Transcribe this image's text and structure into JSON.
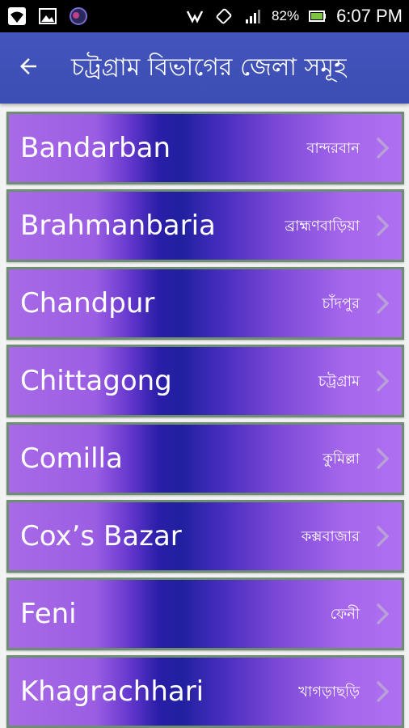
{
  "status_bar": {
    "battery_percent": "82%",
    "time": "6:07 PM",
    "left_icons": [
      "wifi-icon",
      "image-icon",
      "app-notification-icon"
    ],
    "right_icons": [
      "headset-icon",
      "rotate-icon",
      "signal-icon",
      "battery-icon"
    ]
  },
  "app_bar": {
    "title": "চট্রগ্রাম বিভাগের জেলা সমূহ",
    "back_icon": "arrow-left-icon"
  },
  "districts": [
    {
      "name": "Bandarban",
      "bangla": "বান্দরবান"
    },
    {
      "name": "Brahmanbaria",
      "bangla": "ব্রাহ্মণবাড়িয়া"
    },
    {
      "name": "Chandpur",
      "bangla": "চাঁদপুর"
    },
    {
      "name": "Chittagong",
      "bangla": "চট্রগ্রাম"
    },
    {
      "name": "Comilla",
      "bangla": "কুমিল্লা"
    },
    {
      "name": "Cox’s Bazar",
      "bangla": "কক্সবাজার"
    },
    {
      "name": "Feni",
      "bangla": "ফেনী"
    },
    {
      "name": "Khagrachhari",
      "bangla": "খাগড়াছড়ি"
    }
  ],
  "colors": {
    "app_bar": "#3f51b5",
    "item_border": "#6d8f6f",
    "item_gradient_edge": "#a86ae6",
    "item_gradient_center": "#2020a0"
  }
}
